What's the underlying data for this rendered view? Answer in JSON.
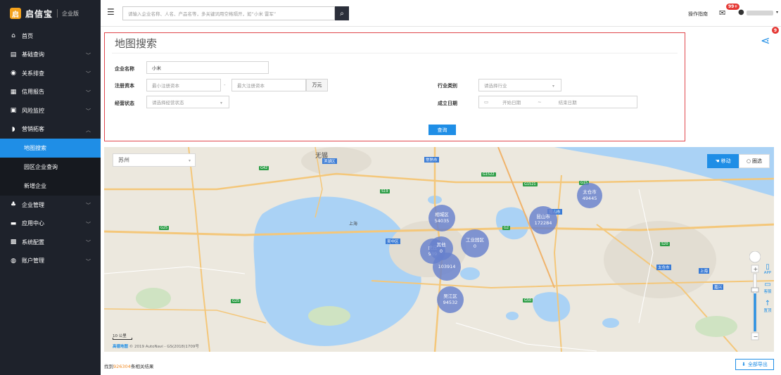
{
  "app": {
    "brand_name": "启信宝",
    "edition": "企业版",
    "logo_glyph": "启"
  },
  "sidebar": {
    "items": [
      {
        "label": "首页",
        "icon": "home-icon",
        "glyph": "⌂",
        "has_children": false
      },
      {
        "label": "基础查询",
        "icon": "clipboard-icon",
        "glyph": "▤",
        "has_children": true
      },
      {
        "label": "关系排查",
        "icon": "relation-icon",
        "glyph": "◉",
        "has_children": true
      },
      {
        "label": "信用报告",
        "icon": "report-icon",
        "glyph": "▦",
        "has_children": true
      },
      {
        "label": "风险监控",
        "icon": "monitor-icon",
        "glyph": "▣",
        "has_children": true
      },
      {
        "label": "营销拓客",
        "icon": "marketing-icon",
        "glyph": "◗",
        "has_children": true,
        "expanded": true
      }
    ],
    "sub_items": [
      {
        "label": "地图搜索",
        "active": true
      },
      {
        "label": "园区企业查询",
        "active": false
      },
      {
        "label": "新增企业",
        "active": false
      }
    ],
    "items_after": [
      {
        "label": "企业管理",
        "icon": "org-icon",
        "glyph": "♣",
        "has_children": true
      },
      {
        "label": "应用中心",
        "icon": "app-center-icon",
        "glyph": "▬",
        "has_children": true
      },
      {
        "label": "系统配置",
        "icon": "settings-grid-icon",
        "glyph": "▩",
        "has_children": true
      },
      {
        "label": "账户管理",
        "icon": "account-icon",
        "glyph": "◍",
        "has_children": true
      }
    ]
  },
  "topbar": {
    "search_placeholder": "请输入企业名称、人名、产品名等，多关键词用空格隔开，如“小米 雷军”",
    "guide_label": "操作指南",
    "mail_badge": "99+"
  },
  "search_form": {
    "title": "地图搜索",
    "company_label": "企业名称",
    "company_value": "小米",
    "capital_label": "注册资本",
    "capital_min_placeholder": "最小注册资本",
    "capital_sep": "-",
    "capital_max_placeholder": "最大注册资本",
    "capital_unit": "万元",
    "industry_label": "行业类别",
    "industry_placeholder": "请选择行业",
    "status_label": "经营状态",
    "status_placeholder": "请选择经营状态",
    "founded_label": "成立日期",
    "date_start_placeholder": "开始日期",
    "date_sep": "~",
    "date_end_placeholder": "结束日期",
    "query_button": "查询"
  },
  "share_badge": "9",
  "map": {
    "city": "苏州",
    "mode_move": "移动",
    "mode_circle": "圈选",
    "clusters": [
      {
        "name": "相城区",
        "count": "54035"
      },
      {
        "name": "昆山市",
        "count": "172284"
      },
      {
        "name": "太仓市",
        "count": "49445"
      },
      {
        "name": "工业园区",
        "count": "0"
      },
      {
        "name": "其他",
        "count": "0"
      },
      {
        "name": "虎丘",
        "count": "939"
      },
      {
        "name": "",
        "count": "103914"
      },
      {
        "name": "吴江区",
        "count": "94532"
      }
    ],
    "towns": [
      "无锡",
      "苏州",
      "上海",
      "吴中区",
      "太仓市",
      "昆山市",
      "常熟市",
      "嘉兴",
      "滨湖区"
    ],
    "side_tools": [
      {
        "label": "APP",
        "glyph": "▯",
        "icon": "app-download-icon"
      },
      {
        "label": "客服",
        "glyph": "▭",
        "icon": "customer-service-icon"
      },
      {
        "label": "置顶",
        "glyph": "↑",
        "icon": "back-to-top-icon"
      }
    ],
    "scale_label": "10 公里",
    "copyright_brand": "高德地图",
    "copyright": "© 2019 AutoNavi - GS(2018)1709号"
  },
  "results": {
    "prefix": "找到",
    "count": "926304",
    "suffix": "条相关结果"
  },
  "export_button": "全部导出"
}
